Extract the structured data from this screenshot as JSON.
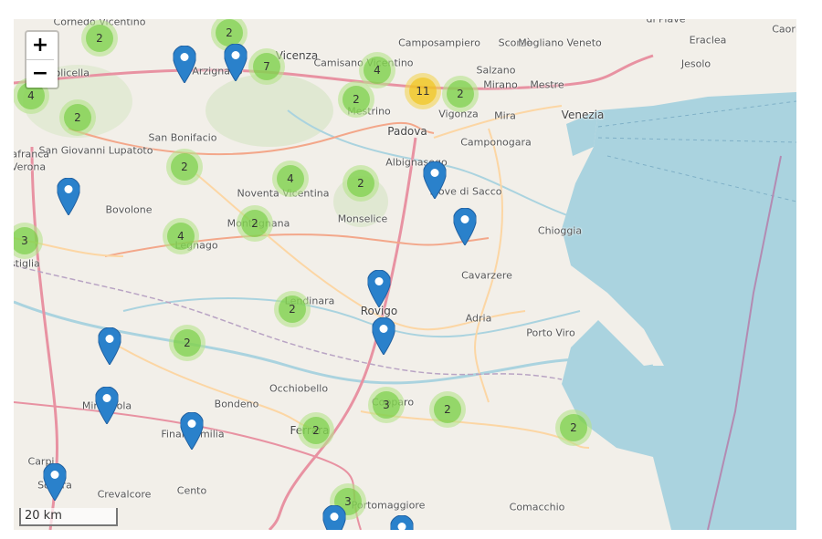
{
  "controls": {
    "zoom_in": "+",
    "zoom_out": "−",
    "scale": "20 km"
  },
  "colors": {
    "land": "#f2efe9",
    "sea": "#aad3df",
    "road_major": "#f3a78a",
    "road_minor": "#fcd6a4",
    "motorway": "#e892a2",
    "cluster_small": "#6ecc39",
    "cluster_medium": "#f0c20c",
    "marker": "#2a81cb"
  },
  "places": [
    {
      "name": "Cornedo Vicentino"
    },
    {
      "name": "Vicenza"
    },
    {
      "name": "Camisano Vicentino"
    },
    {
      "name": "Camposampiero"
    },
    {
      "name": "Scorzè"
    },
    {
      "name": "Mogliano Veneto"
    },
    {
      "name": "di Piave"
    },
    {
      "name": "Eraclea"
    },
    {
      "name": "Caorle"
    },
    {
      "name": "Jesolo"
    },
    {
      "name": "Salzano"
    },
    {
      "name": "Mirano"
    },
    {
      "name": "Mestre"
    },
    {
      "name": "Venezia"
    },
    {
      "name": "Mira"
    },
    {
      "name": "Vigonza"
    },
    {
      "name": "Padova"
    },
    {
      "name": "Mestrino"
    },
    {
      "name": "Camponogara"
    },
    {
      "name": "Albignasego"
    },
    {
      "name": "Piove di Sacco"
    },
    {
      "name": "Chioggia"
    },
    {
      "name": "San Giovanni Lupatoto"
    },
    {
      "name": "San Bonifacio"
    },
    {
      "name": "Noventa Vicentina"
    },
    {
      "name": "Bovolone"
    },
    {
      "name": "Montagnana"
    },
    {
      "name": "Monselice"
    },
    {
      "name": "Legnago"
    },
    {
      "name": "Cavarzere"
    },
    {
      "name": "Lendinara"
    },
    {
      "name": "Rovigo"
    },
    {
      "name": "Adria"
    },
    {
      "name": "Porto Viro"
    },
    {
      "name": "Occhiobello"
    },
    {
      "name": "Mirandola"
    },
    {
      "name": "Bondeno"
    },
    {
      "name": "Finale Emilia"
    },
    {
      "name": "Copparo"
    },
    {
      "name": "Ferrara"
    },
    {
      "name": "Soliera"
    },
    {
      "name": "Crevalcore"
    },
    {
      "name": "Cento"
    },
    {
      "name": "Portomaggiore"
    },
    {
      "name": "Comacchio"
    },
    {
      "name": "Arzignano"
    },
    {
      "name": "Valpolicella"
    },
    {
      "name": "Verona"
    },
    {
      "name": "Villafranca"
    },
    {
      "name": "Ostiglia"
    },
    {
      "name": "Carpi"
    }
  ],
  "clusters": [
    {
      "count": "2",
      "size": "small"
    },
    {
      "count": "2",
      "size": "small"
    },
    {
      "count": "7",
      "size": "small"
    },
    {
      "count": "4",
      "size": "small"
    },
    {
      "count": "2",
      "size": "small"
    },
    {
      "count": "11",
      "size": "medium"
    },
    {
      "count": "2",
      "size": "small"
    },
    {
      "count": "2",
      "size": "small"
    },
    {
      "count": "4",
      "size": "small"
    },
    {
      "count": "2",
      "size": "small"
    },
    {
      "count": "4",
      "size": "small"
    },
    {
      "count": "2",
      "size": "small"
    },
    {
      "count": "2",
      "size": "small"
    },
    {
      "count": "4",
      "size": "small"
    },
    {
      "count": "3",
      "size": "small"
    },
    {
      "count": "2",
      "size": "small"
    },
    {
      "count": "2",
      "size": "small"
    },
    {
      "count": "3",
      "size": "small"
    },
    {
      "count": "2",
      "size": "small"
    },
    {
      "count": "2",
      "size": "small"
    },
    {
      "count": "2",
      "size": "small"
    },
    {
      "count": "3",
      "size": "small"
    }
  ],
  "marker_count": 13
}
